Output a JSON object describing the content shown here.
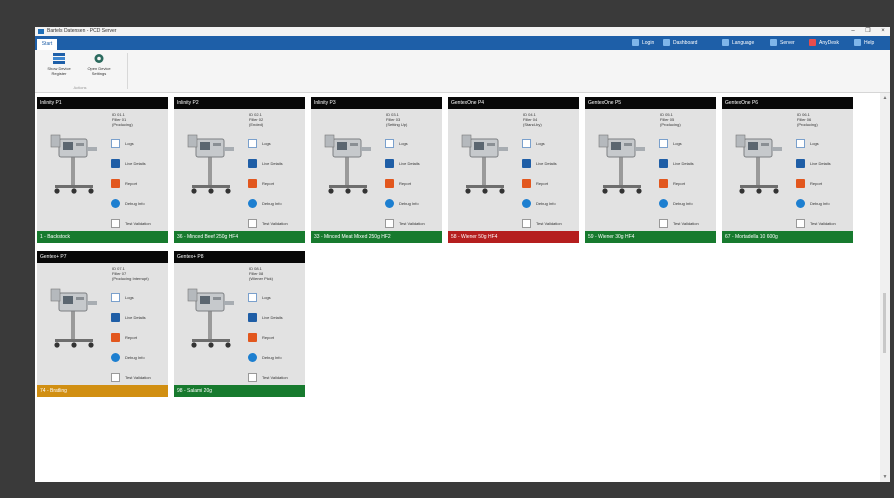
{
  "window": {
    "title": "Bartels Datensen - PCD Server",
    "controls": {
      "minimize": "–",
      "maximize": "❐",
      "close": "×"
    }
  },
  "ribbon_tabs": {
    "file": "Start",
    "right": [
      {
        "label": "Login",
        "icon": "user-icon",
        "color": "#7fb6ea"
      },
      {
        "label": "Dashboard",
        "icon": "dashboard-icon",
        "color": "#7fb6ea"
      },
      {
        "label": "Language",
        "icon": "globe-icon",
        "color": "#7fb6ea"
      },
      {
        "label": "Server",
        "icon": "server-icon",
        "color": "#7fb6ea"
      },
      {
        "label": "AnyDesk",
        "icon": "anydesk-icon",
        "color": "#e84d4d"
      },
      {
        "label": "Help",
        "icon": "help-icon",
        "color": "#7fb6ea"
      }
    ]
  },
  "ribbon": {
    "buttons": [
      {
        "label": "Show Device Register",
        "icon": "device-register-icon"
      },
      {
        "label": "Open Device Settings",
        "icon": "gear-icon"
      }
    ],
    "group_label": "Actions"
  },
  "actions": [
    "Logs",
    "Live Details",
    "Report",
    "Debug Info",
    "Test Validation"
  ],
  "status_colors": {
    "ok": "#177a2e",
    "error": "#b51e1e",
    "warning": "#d18f12"
  },
  "cards": [
    {
      "title": "Inlinity P1",
      "info": [
        "ID 01.1",
        "Filler 01",
        "(Producing)"
      ],
      "footer": "1 - Backstock",
      "status": "ok"
    },
    {
      "title": "Inlinity P2",
      "info": [
        "ID 02.1",
        "Filler 02",
        "(Ended)"
      ],
      "footer": "36 - Minced Beef 250g HF4",
      "status": "ok"
    },
    {
      "title": "Inlinity P3",
      "info": [
        "ID 03.1",
        "Filler 03",
        "(Setting Up)"
      ],
      "footer": "33 - Minced Meat Mixed 250g HF2",
      "status": "ok"
    },
    {
      "title": "GentexOne P4",
      "info": [
        "ID 04.1",
        "Filler 04",
        "(Stand-by)"
      ],
      "footer": "58 - Wiener 50g HF4",
      "status": "error"
    },
    {
      "title": "GentexOne P5",
      "info": [
        "ID 05.1",
        "Filler 05",
        "(Producing)"
      ],
      "footer": "59 - Wiener 30g HF4",
      "status": "ok"
    },
    {
      "title": "GentexOne P6",
      "info": [
        "ID 06.1",
        "Filler 06",
        "(Producing)"
      ],
      "footer": "67 - Mortadella 10 600g",
      "status": "ok"
    },
    {
      "title": "Gentex+ P7",
      "info": [
        "ID 07.1",
        "Filler 07",
        "(Producing Interrupt)"
      ],
      "footer": "74 - Bratling",
      "status": "warning"
    },
    {
      "title": "Gentex+ P8",
      "info": [
        "ID 08.1",
        "Filler 08",
        "(Wiener Pick)"
      ],
      "footer": "98 - Salami 20g",
      "status": "ok"
    }
  ]
}
